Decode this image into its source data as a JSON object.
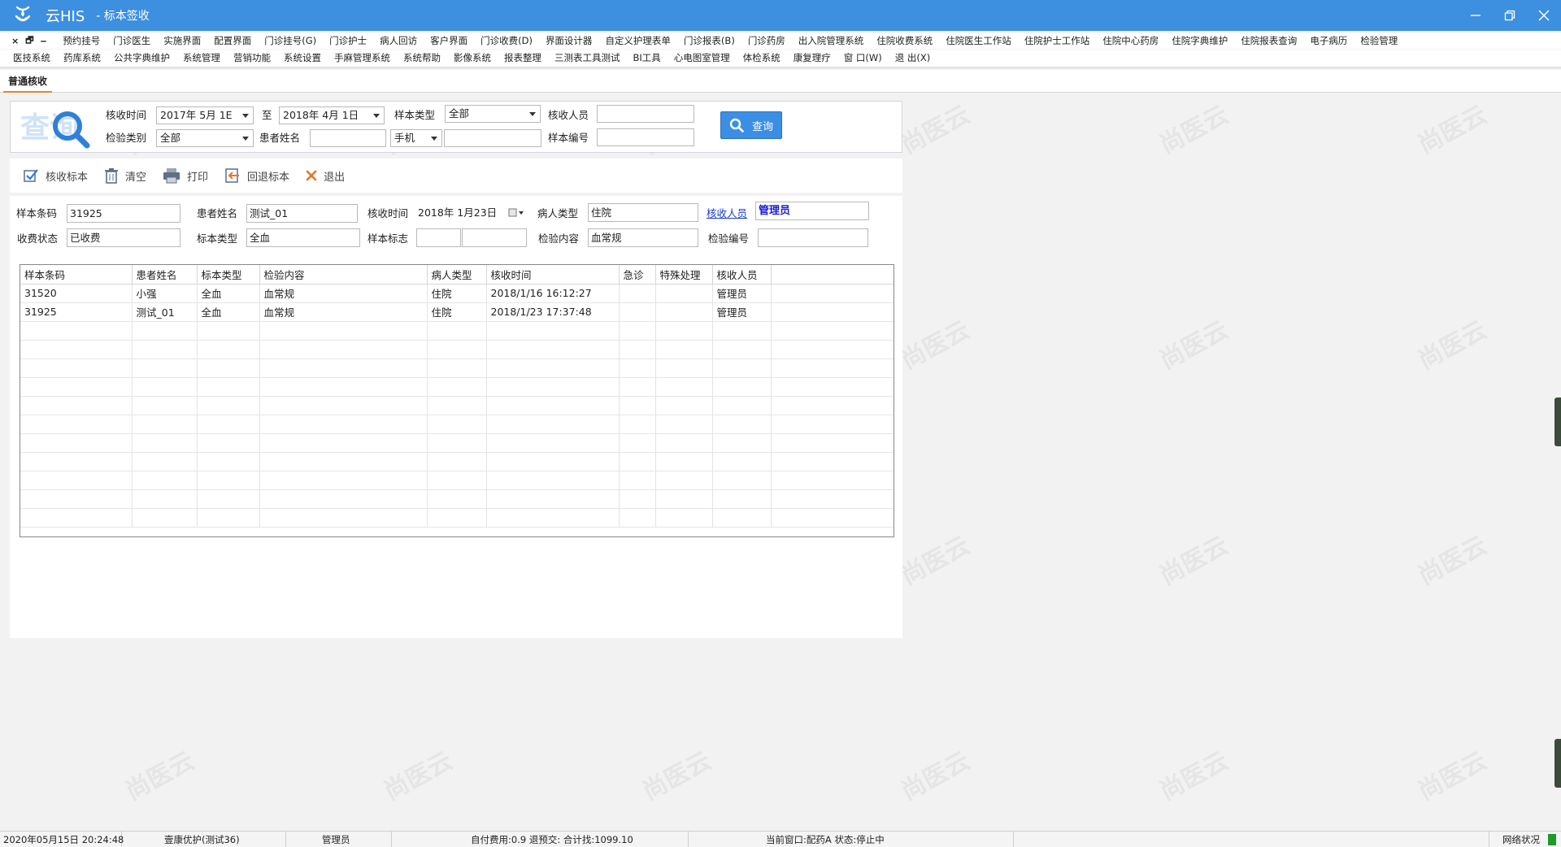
{
  "window": {
    "app_name": "云HIS",
    "title": "- 标本签收",
    "controls": [
      "minimize",
      "restore",
      "close"
    ]
  },
  "menu": {
    "mdi_controls": [
      "×",
      "🗗",
      "‒"
    ],
    "row1": [
      "预约挂号",
      "门诊医生",
      "实施界面",
      "配置界面",
      "门诊挂号(G)",
      "门诊护士",
      "病人回访",
      "客户界面",
      "门诊收费(D)",
      "界面设计器",
      "自定义护理表单",
      "门诊报表(B)",
      "门诊药房",
      "出入院管理系统",
      "住院收费系统",
      "住院医生工作站",
      "住院护士工作站",
      "住院中心药房",
      "住院字典维护",
      "住院报表查询",
      "电子病历",
      "检验管理"
    ],
    "row2": [
      "医技系统",
      "药库系统",
      "公共字典维护",
      "系统管理",
      "营销功能",
      "系统设置",
      "手麻管理系统",
      "系统帮助",
      "影像系统",
      "报表整理",
      "三测表工具测试",
      "BI工具",
      "心电图室管理",
      "体检系统",
      "康复理疗",
      "窗 口(W)",
      "退 出(X)"
    ]
  },
  "tab": {
    "label": "普通核收"
  },
  "query": {
    "logo_text": "查询",
    "receive_time_label": "核收时间",
    "date_from": "2017年  5月  1E",
    "to_label": "至",
    "date_to": "2018年  4月  1日",
    "sample_type_label": "样本类型",
    "sample_type_value": "全部",
    "receiver_label": "核收人员",
    "receiver_value": "",
    "test_category_label": "检验类别",
    "test_category_value": "全部",
    "patient_name_label": "患者姓名",
    "patient_name_value": "",
    "phone_type_value": "手机",
    "phone_value": "",
    "sample_no_label": "样本编号",
    "sample_no_value": "",
    "search_button": "查询"
  },
  "toolbar": {
    "receive": "核收标本",
    "clear": "清空",
    "print": "打印",
    "return": "回退标本",
    "exit": "退出"
  },
  "detail": {
    "barcode_label": "样本条码",
    "barcode_value": "31925",
    "patient_name_label": "患者姓名",
    "patient_name_value": "测试_01",
    "receive_time_label": "核收时间",
    "receive_time_value": "2018年  1月23日",
    "patient_type_label": "病人类型",
    "patient_type_value": "住院",
    "receiver_label": "核收人员",
    "receiver_value": "管理员",
    "fee_status_label": "收费状态",
    "fee_status_value": "已收费",
    "specimen_type_label": "标本类型",
    "specimen_type_value": "全血",
    "sample_flag_label": "样本标志",
    "sample_flag_value1": "",
    "sample_flag_value2": "",
    "test_content_label": "检验内容",
    "test_content_value": "血常规",
    "test_no_label": "检验编号",
    "test_no_value": ""
  },
  "grid": {
    "columns": [
      "样本条码",
      "患者姓名",
      "标本类型",
      "检验内容",
      "病人类型",
      "核收时间",
      "急诊",
      "特殊处理",
      "核收人员"
    ],
    "rows": [
      [
        "31520",
        "小强",
        "全血",
        "血常规",
        "住院",
        "2018/1/16 16:12:27",
        "",
        "",
        "管理员"
      ],
      [
        "31925",
        "测试_01",
        "全血",
        "血常规",
        "住院",
        "2018/1/23 17:37:48",
        "",
        "",
        "管理员"
      ]
    ]
  },
  "watermark_text": "尚医云",
  "status": {
    "datetime": "2020年05月15日 20:24:48",
    "org": "壹康优护(测试36)",
    "user": "管理员",
    "fees": "自付费用:0.9 退预交: 合计找:1099.10",
    "window": "当前窗口:配药A  状态:停止中",
    "network": "网络状况"
  },
  "colors": {
    "titlebar": "#3d8fe0",
    "accent_button": "#3b8ee3",
    "tab_underline": "#e08a2e",
    "link": "#1a3fd0",
    "network_ok": "#1d9a2b"
  }
}
